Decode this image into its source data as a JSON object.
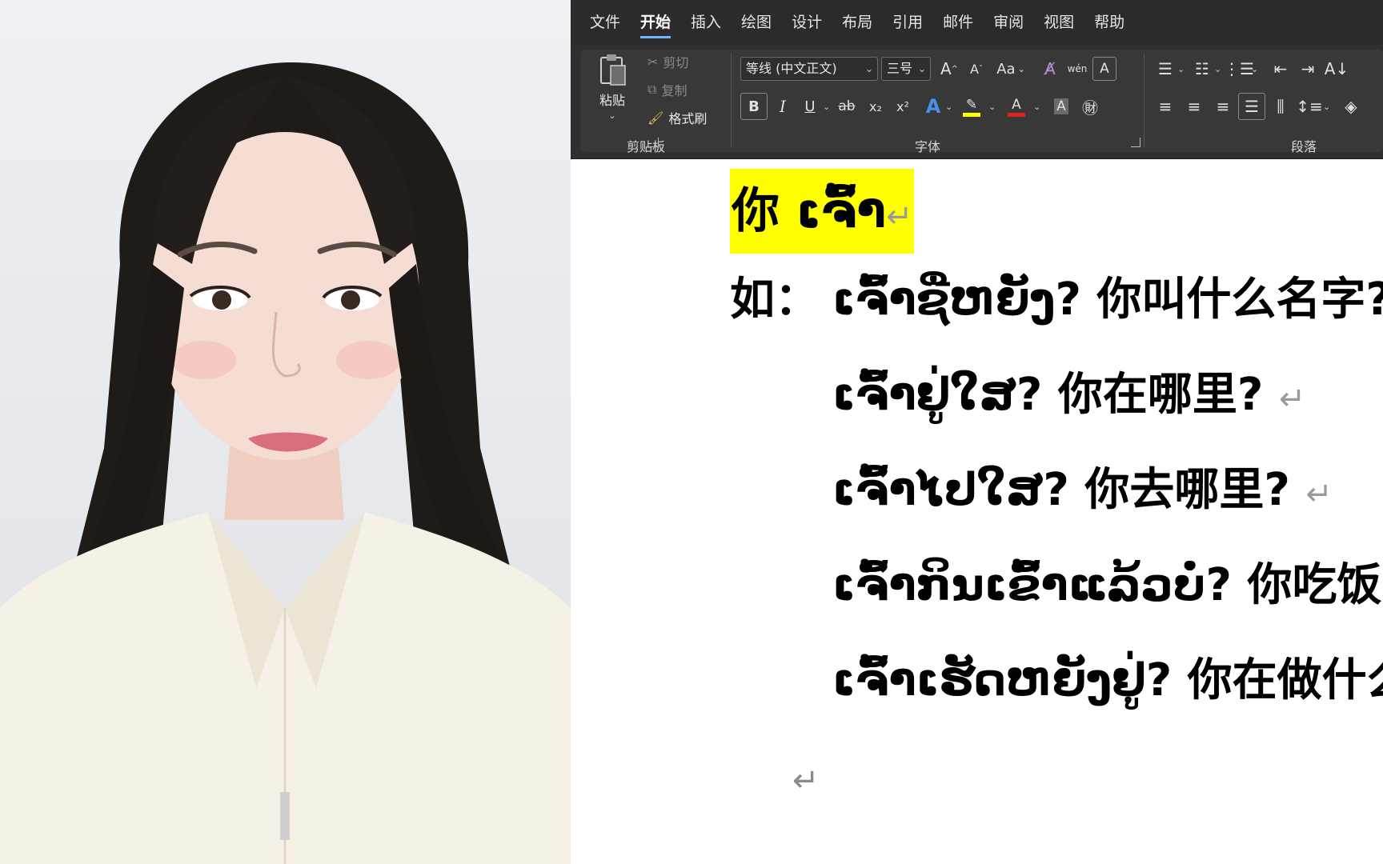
{
  "ribbon": {
    "tabs": [
      "文件",
      "开始",
      "插入",
      "绘图",
      "设计",
      "布局",
      "引用",
      "邮件",
      "审阅",
      "视图",
      "帮助"
    ],
    "active_tab": "开始",
    "clipboard": {
      "paste": "粘贴",
      "cut": "剪切",
      "copy": "复制",
      "format_painter": "格式刷",
      "group_label": "剪贴板"
    },
    "font": {
      "font_name": "等线 (中文正文)",
      "font_size": "三号",
      "bold": "B",
      "italic": "I",
      "underline": "U",
      "strike": "ab",
      "subscript": "x₂",
      "superscript": "x²",
      "case": "Aa",
      "grow": "A",
      "shrink": "A",
      "group_label": "字体",
      "highlight_color": "#ffff00",
      "font_color": "#e02020"
    },
    "paragraph": {
      "group_label": "段落"
    }
  },
  "document": {
    "heading": "你 ເຈົ້າ",
    "prefix": "如：",
    "lines": [
      "ເຈົ້າຊື່ຫຍັງ? 你叫什么名字?",
      "ເຈົ້າຢູ່ໃສ? 你在哪里?",
      "ເຈົ້າໄປໃສ? 你去哪里?",
      "ເຈົ້າກິນເຂົ້າແລ້ວບໍ່? 你吃饭了",
      "ເຈົ້າເຮັດຫຍັງຢູ່? 你在做什么"
    ],
    "return_mark": "↵"
  }
}
